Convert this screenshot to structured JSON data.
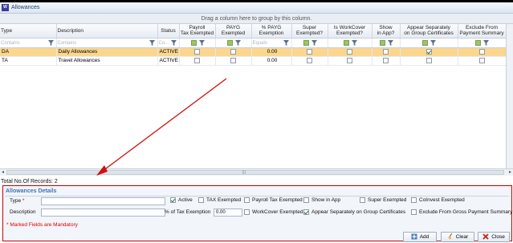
{
  "window": {
    "title": "Allowances"
  },
  "grid": {
    "group_hint": "Drag a column here to group by this column.",
    "columns": [
      {
        "label": "Type"
      },
      {
        "label": "Description"
      },
      {
        "label": "Status"
      },
      {
        "label": "Payroll\nTax Exempted"
      },
      {
        "label": "PAYG\nExempted"
      },
      {
        "label": "% PAYG\nExemption"
      },
      {
        "label": "Super\nExempted?"
      },
      {
        "label": "Is WorkCover\nExempted?"
      },
      {
        "label": "Show\nin App?"
      },
      {
        "label": "Appear Separately\non Group Certificates"
      },
      {
        "label": "Exclude From\nPayment Summary"
      }
    ],
    "filters": {
      "type": "Contains",
      "description": "Contains",
      "status": "Co...",
      "pct": "Equals"
    },
    "rows": [
      {
        "type": "DA",
        "description": "Daily Allowances",
        "status": "ACTIVE",
        "pct": "0.00",
        "appear_separately": true
      },
      {
        "type": "TA",
        "description": "Travel Allowances",
        "status": "ACTIVE",
        "pct": "0.00",
        "appear_separately": false
      }
    ]
  },
  "total_records": "Total No.Of Records: 2",
  "details": {
    "title": "Allowances  Details",
    "type_label": "Type *",
    "description_label": "Description",
    "pct_label": "% of Tax Exemption",
    "pct_value": "0.00",
    "checks": {
      "active": {
        "label": "Active",
        "checked": true
      },
      "tax_exempted": {
        "label": "TAX Exempted",
        "checked": false
      },
      "payroll_tax_exempted": {
        "label": "Payroll Tax Exempted",
        "checked": false
      },
      "show_in_app": {
        "label": "Show in App",
        "checked": false
      },
      "super_exempted": {
        "label": "Super Exempted",
        "checked": false
      },
      "coinvest_exempted": {
        "label": "CoInvest Exempted",
        "checked": false
      },
      "workcover_exempted": {
        "label": "WorkCover Exempted",
        "checked": false
      },
      "appear_separately": {
        "label": "Appear Separately on Group Certificates",
        "checked": true
      },
      "exclude_gross": {
        "label": "Exclude From Gross Payment Summary",
        "checked": false
      }
    },
    "mandatory_note": "* Marked Fields are Mandatory"
  },
  "buttons": {
    "add": "Add",
    "clear": "Clear",
    "close": "Close"
  },
  "colors": {
    "selected_row": "#fbd68f",
    "accent": "#3d73c0",
    "annotation": "#cc0000"
  }
}
